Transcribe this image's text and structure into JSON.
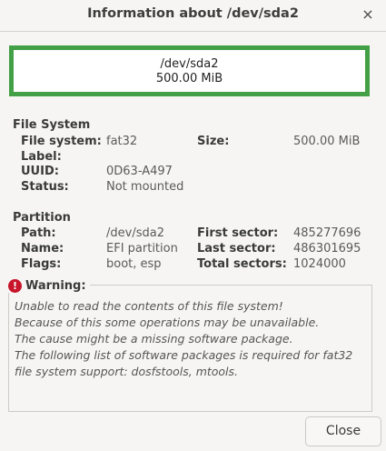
{
  "window": {
    "title": "Information about /dev/sda2",
    "close_glyph": "×"
  },
  "partition_box": {
    "name": "/dev/sda2",
    "size": "500.00 MiB",
    "accent_color": "#43a047"
  },
  "filesystem": {
    "heading": "File System",
    "fs_label": "File system:",
    "fs_value": "fat32",
    "label_label": "Label:",
    "label_value": "",
    "uuid_label": "UUID:",
    "uuid_value": "0D63-A497",
    "status_label": "Status:",
    "status_value": "Not mounted",
    "size_label": "Size:",
    "size_value": "500.00 MiB"
  },
  "partition": {
    "heading": "Partition",
    "path_label": "Path:",
    "path_value": "/dev/sda2",
    "name_label": "Name:",
    "name_value": "EFI partition",
    "flags_label": "Flags:",
    "flags_value": "boot, esp",
    "first_label": "First sector:",
    "first_value": "485277696",
    "last_label": "Last sector:",
    "last_value": "486301695",
    "total_label": "Total sectors:",
    "total_value": "1024000"
  },
  "warning": {
    "icon": "error-icon",
    "heading": "Warning:",
    "lines": [
      "Unable to read the contents of this file system!",
      "Because of this some operations may be unavailable.",
      "The cause might be a missing software package.",
      "The following list of software packages is required for fat32",
      "file system support:  dosfstools, mtools."
    ]
  },
  "buttons": {
    "close_label": "Close"
  }
}
